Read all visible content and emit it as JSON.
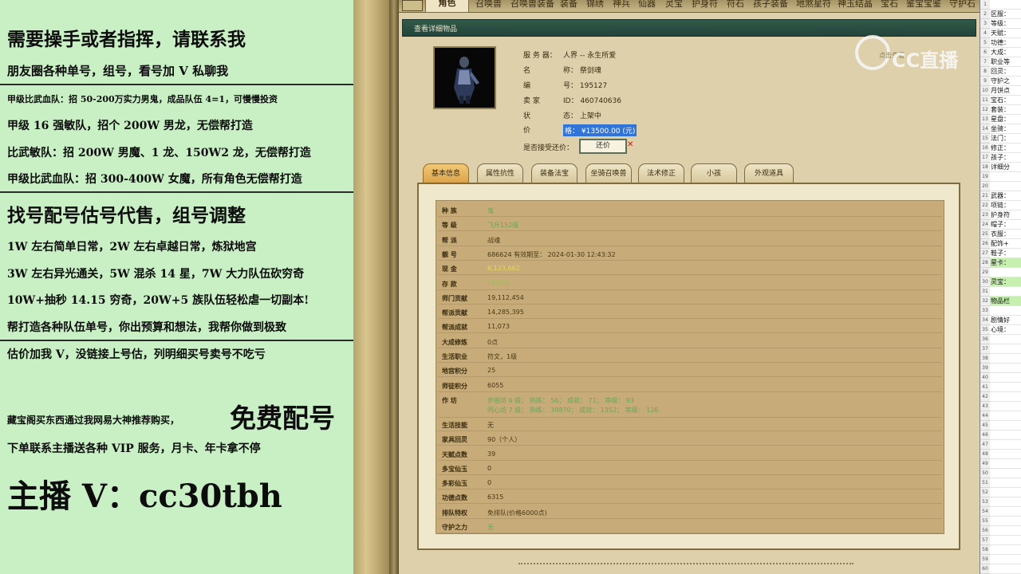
{
  "left_panel": {
    "line1": "需要操手或者指挥，请联系我",
    "line2": "朋友圈各种单号，组号，看号加 V 私聊我",
    "line3": "甲级比武血队：招 50-200万实力男鬼，成品队伍 4=1，可慢慢投资",
    "line4": "甲级 16 强敏队，招个 200W 男龙，无偿帮打造",
    "line5": "比武敏队：招 200W 男魔、1 龙、150W2 龙，无偿帮打造",
    "line6": "甲级比武血队：招 300-400W 女魔，所有角色无偿帮打造",
    "line7": "找号配号估号代售，组号调整",
    "line8": "1W 左右简单日常，2W 左右卓越日常，炼狱地宫",
    "line9": "3W 左右异光通关，5W 混杀 14 星，7W 大力队伍砍穷奇",
    "line10": "10W+抽秒 14.15 穷奇，20W+5 族队伍轻松虐一切副本!",
    "line11": "帮打造各种队伍单号，你出预算和想法，我帮你做到极致",
    "line12": "估价加我 V，没链接上号估，列明细买号卖号不吃亏",
    "line13_small": "藏宝阁买东西通过我网易大神推荐购买，",
    "line13_big": "免费配号",
    "line14": "下单联系主播送各种 VIP 服务，月卡、年卡拿不停",
    "line15": "主播 V：cc30tbh"
  },
  "topnav": {
    "tabs": [
      "角色",
      "召唤兽",
      "召唤兽装备",
      "装备",
      "锦绣",
      "神兵",
      "仙器",
      "灵宝",
      "护身符",
      "符石",
      "孩子装备",
      "地煞星符",
      "神玉结晶",
      "宝石",
      "鉴宝宝鉴",
      "守护石"
    ]
  },
  "window": {
    "title": "查看详细物品"
  },
  "info": {
    "server_label": "服 务 器：",
    "server_value": "人界 -- 永生所爱",
    "name_label": "名",
    "name_value": "称：   祭剑魂",
    "id_label": "编",
    "id_value": "号：   195127",
    "seller_label": "卖  家",
    "seller_value": "ID：   460740636",
    "status_label": "状",
    "status_value": "态：   上架中",
    "price_label": "价",
    "price_value": "格：  ¥13500.00 (元)",
    "counter_label": "是否接受还价：",
    "counter_button": "还价"
  },
  "subtabs": [
    "基本信息",
    "属性抗性",
    "装备法宝",
    "坐骑召唤兽",
    "法术修正",
    "小孩",
    "外观道具"
  ],
  "details": [
    {
      "k": "种    族",
      "v": "鬼",
      "c": "green"
    },
    {
      "k": "等    级",
      "v": "飞升152级",
      "c": "green"
    },
    {
      "k": "帮    派",
      "v": "战魂",
      "c": ""
    },
    {
      "k": "靓    号",
      "v": "686624    有效期至：   2024-01-30 12:43:32",
      "c": ""
    },
    {
      "k": "现    金",
      "v": "6,123,662",
      "c": "yellow"
    },
    {
      "k": "存    款",
      "v": "18,010",
      "c": "green2"
    },
    {
      "k": "师门贡献",
      "v": "19,112,454",
      "c": ""
    },
    {
      "k": "帮派贡献",
      "v": "14,285,395",
      "c": ""
    },
    {
      "k": "帮派成就",
      "v": "11,073",
      "c": ""
    },
    {
      "k": "大成修炼",
      "v": "0点",
      "c": ""
    },
    {
      "k": "生活职业",
      "v": "符文，1级",
      "c": ""
    },
    {
      "k": "地宫积分",
      "v": "25",
      "c": ""
    },
    {
      "k": "师徒积分",
      "v": "6055",
      "c": ""
    },
    {
      "k": "作    坊",
      "v": "步摇坊 6 级；  熟练：  56；  成就：  71；  等级：  93",
      "v2": "同心坊 7 级；  熟练：  39870；  成就：  1352；  等级：  126",
      "c": "green"
    },
    {
      "k": "生活技能",
      "v": "无",
      "c": ""
    },
    {
      "k": "家具回灵",
      "v": "90（个人）",
      "c": ""
    },
    {
      "k": "天赋点数",
      "v": "39",
      "c": ""
    },
    {
      "k": "多宝仙玉",
      "v": "0",
      "c": ""
    },
    {
      "k": "多彩仙玉",
      "v": "0",
      "c": ""
    },
    {
      "k": "功德点数",
      "v": "6315",
      "c": ""
    },
    {
      "k": "排队特权",
      "v": "免排队(价格6000点)",
      "c": ""
    },
    {
      "k": "守护之力",
      "v": "无",
      "c": "green"
    }
  ],
  "watermark": {
    "logo": "CC直播",
    "small": "点击查看"
  },
  "sheet": {
    "rows": [
      "",
      "区服：",
      "等级：",
      "天赋：",
      "功德：",
      "大成：",
      "职业等",
      "回灵：",
      "守护之",
      "月饼点",
      "宝石：",
      "套装：",
      "星盘：",
      "坐骑：",
      "法门：",
      "修正：",
      "孩子：",
      "详细分",
      "",
      "",
      "武器：",
      "项链：",
      "护身符",
      "帽子：",
      "衣服：",
      "配饰+",
      "鞋子：",
      "星卡：",
      "",
      "灵宝：",
      "",
      "物品栏",
      "",
      "剧情好",
      "心境：",
      "",
      "",
      "",
      "",
      "",
      "",
      "",
      "",
      "",
      "",
      "",
      "",
      "",
      "",
      "",
      "",
      "",
      "",
      "",
      "",
      "",
      "",
      "",
      "",
      ""
    ],
    "highlight_rows": [
      27,
      29,
      31
    ]
  },
  "colors": {
    "left_bg": "#c9f0c5",
    "window_bg": "#ddd0ab",
    "title_bar": "#2a4d40",
    "price_highlight": "#2f74d6",
    "active_subtab": "#e5b35c"
  }
}
